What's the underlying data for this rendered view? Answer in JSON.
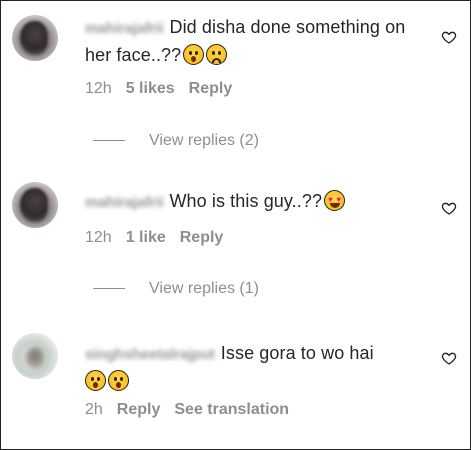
{
  "comments": [
    {
      "username": "mahirajafrii",
      "text": "Did disha done something on her face..??",
      "emojis": [
        "astonished-emoji",
        "sad-emoji"
      ],
      "time": "12h",
      "likes": "5 likes",
      "reply": "Reply",
      "view_replies": "View replies (2)"
    },
    {
      "username": "mahirajafrii",
      "text": "Who is this guy..??",
      "emojis": [
        "heart-eyes-emoji"
      ],
      "time": "12h",
      "likes": "1 like",
      "reply": "Reply",
      "view_replies": "View replies (1)"
    },
    {
      "username": "singhsheetalrajput",
      "text": "Isse gora to wo hai",
      "emojis": [
        "astonished-emoji",
        "astonished-emoji"
      ],
      "time": "2h",
      "reply": "Reply",
      "see_translation": "See translation"
    }
  ],
  "icons": {
    "like": "heart-outline-icon"
  },
  "colors": {
    "text": "#262626",
    "meta": "#8e8e8e"
  }
}
